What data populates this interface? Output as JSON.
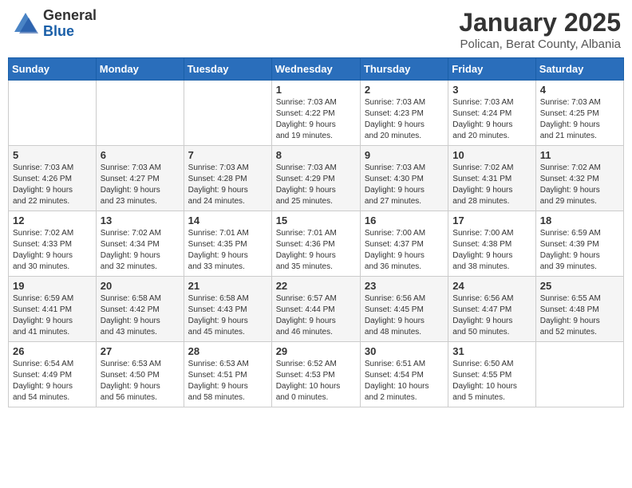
{
  "header": {
    "logo_general": "General",
    "logo_blue": "Blue",
    "title": "January 2025",
    "subtitle": "Polican, Berat County, Albania"
  },
  "days_of_week": [
    "Sunday",
    "Monday",
    "Tuesday",
    "Wednesday",
    "Thursday",
    "Friday",
    "Saturday"
  ],
  "weeks": [
    [
      {
        "day": "",
        "detail": ""
      },
      {
        "day": "",
        "detail": ""
      },
      {
        "day": "",
        "detail": ""
      },
      {
        "day": "1",
        "detail": "Sunrise: 7:03 AM\nSunset: 4:22 PM\nDaylight: 9 hours\nand 19 minutes."
      },
      {
        "day": "2",
        "detail": "Sunrise: 7:03 AM\nSunset: 4:23 PM\nDaylight: 9 hours\nand 20 minutes."
      },
      {
        "day": "3",
        "detail": "Sunrise: 7:03 AM\nSunset: 4:24 PM\nDaylight: 9 hours\nand 20 minutes."
      },
      {
        "day": "4",
        "detail": "Sunrise: 7:03 AM\nSunset: 4:25 PM\nDaylight: 9 hours\nand 21 minutes."
      }
    ],
    [
      {
        "day": "5",
        "detail": "Sunrise: 7:03 AM\nSunset: 4:26 PM\nDaylight: 9 hours\nand 22 minutes."
      },
      {
        "day": "6",
        "detail": "Sunrise: 7:03 AM\nSunset: 4:27 PM\nDaylight: 9 hours\nand 23 minutes."
      },
      {
        "day": "7",
        "detail": "Sunrise: 7:03 AM\nSunset: 4:28 PM\nDaylight: 9 hours\nand 24 minutes."
      },
      {
        "day": "8",
        "detail": "Sunrise: 7:03 AM\nSunset: 4:29 PM\nDaylight: 9 hours\nand 25 minutes."
      },
      {
        "day": "9",
        "detail": "Sunrise: 7:03 AM\nSunset: 4:30 PM\nDaylight: 9 hours\nand 27 minutes."
      },
      {
        "day": "10",
        "detail": "Sunrise: 7:02 AM\nSunset: 4:31 PM\nDaylight: 9 hours\nand 28 minutes."
      },
      {
        "day": "11",
        "detail": "Sunrise: 7:02 AM\nSunset: 4:32 PM\nDaylight: 9 hours\nand 29 minutes."
      }
    ],
    [
      {
        "day": "12",
        "detail": "Sunrise: 7:02 AM\nSunset: 4:33 PM\nDaylight: 9 hours\nand 30 minutes."
      },
      {
        "day": "13",
        "detail": "Sunrise: 7:02 AM\nSunset: 4:34 PM\nDaylight: 9 hours\nand 32 minutes."
      },
      {
        "day": "14",
        "detail": "Sunrise: 7:01 AM\nSunset: 4:35 PM\nDaylight: 9 hours\nand 33 minutes."
      },
      {
        "day": "15",
        "detail": "Sunrise: 7:01 AM\nSunset: 4:36 PM\nDaylight: 9 hours\nand 35 minutes."
      },
      {
        "day": "16",
        "detail": "Sunrise: 7:00 AM\nSunset: 4:37 PM\nDaylight: 9 hours\nand 36 minutes."
      },
      {
        "day": "17",
        "detail": "Sunrise: 7:00 AM\nSunset: 4:38 PM\nDaylight: 9 hours\nand 38 minutes."
      },
      {
        "day": "18",
        "detail": "Sunrise: 6:59 AM\nSunset: 4:39 PM\nDaylight: 9 hours\nand 39 minutes."
      }
    ],
    [
      {
        "day": "19",
        "detail": "Sunrise: 6:59 AM\nSunset: 4:41 PM\nDaylight: 9 hours\nand 41 minutes."
      },
      {
        "day": "20",
        "detail": "Sunrise: 6:58 AM\nSunset: 4:42 PM\nDaylight: 9 hours\nand 43 minutes."
      },
      {
        "day": "21",
        "detail": "Sunrise: 6:58 AM\nSunset: 4:43 PM\nDaylight: 9 hours\nand 45 minutes."
      },
      {
        "day": "22",
        "detail": "Sunrise: 6:57 AM\nSunset: 4:44 PM\nDaylight: 9 hours\nand 46 minutes."
      },
      {
        "day": "23",
        "detail": "Sunrise: 6:56 AM\nSunset: 4:45 PM\nDaylight: 9 hours\nand 48 minutes."
      },
      {
        "day": "24",
        "detail": "Sunrise: 6:56 AM\nSunset: 4:47 PM\nDaylight: 9 hours\nand 50 minutes."
      },
      {
        "day": "25",
        "detail": "Sunrise: 6:55 AM\nSunset: 4:48 PM\nDaylight: 9 hours\nand 52 minutes."
      }
    ],
    [
      {
        "day": "26",
        "detail": "Sunrise: 6:54 AM\nSunset: 4:49 PM\nDaylight: 9 hours\nand 54 minutes."
      },
      {
        "day": "27",
        "detail": "Sunrise: 6:53 AM\nSunset: 4:50 PM\nDaylight: 9 hours\nand 56 minutes."
      },
      {
        "day": "28",
        "detail": "Sunrise: 6:53 AM\nSunset: 4:51 PM\nDaylight: 9 hours\nand 58 minutes."
      },
      {
        "day": "29",
        "detail": "Sunrise: 6:52 AM\nSunset: 4:53 PM\nDaylight: 10 hours\nand 0 minutes."
      },
      {
        "day": "30",
        "detail": "Sunrise: 6:51 AM\nSunset: 4:54 PM\nDaylight: 10 hours\nand 2 minutes."
      },
      {
        "day": "31",
        "detail": "Sunrise: 6:50 AM\nSunset: 4:55 PM\nDaylight: 10 hours\nand 5 minutes."
      },
      {
        "day": "",
        "detail": ""
      }
    ]
  ]
}
